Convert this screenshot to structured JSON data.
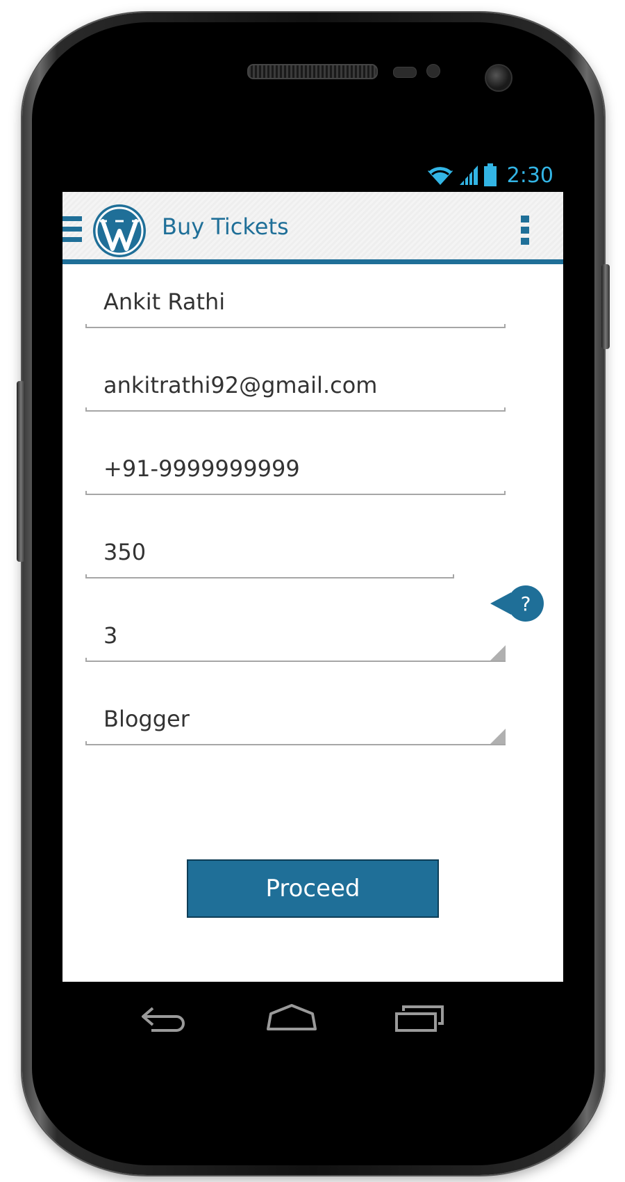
{
  "status_bar": {
    "time": "2:30",
    "icons": [
      "wifi-icon",
      "cellular-signal-icon",
      "battery-icon"
    ]
  },
  "action_bar": {
    "title": "Buy Tickets",
    "menu_icon": "hamburger-menu-icon",
    "logo": "wordpress-logo",
    "overflow_icon": "more-vertical-icon"
  },
  "form": {
    "name": "Ankit Rathi",
    "email": "ankitrathi92@gmail.com",
    "phone": "+91-9999999999",
    "amount": "350",
    "help_label": "?",
    "quantity": "3",
    "category": "Blogger",
    "proceed_label": "Proceed"
  },
  "nav_bar": {
    "icons": [
      "back-icon",
      "home-icon",
      "recent-apps-icon"
    ]
  },
  "colors": {
    "accent": "#1f6f98",
    "status_accent": "#33b5e5",
    "text": "#333333",
    "underline": "#a6a6a6"
  }
}
